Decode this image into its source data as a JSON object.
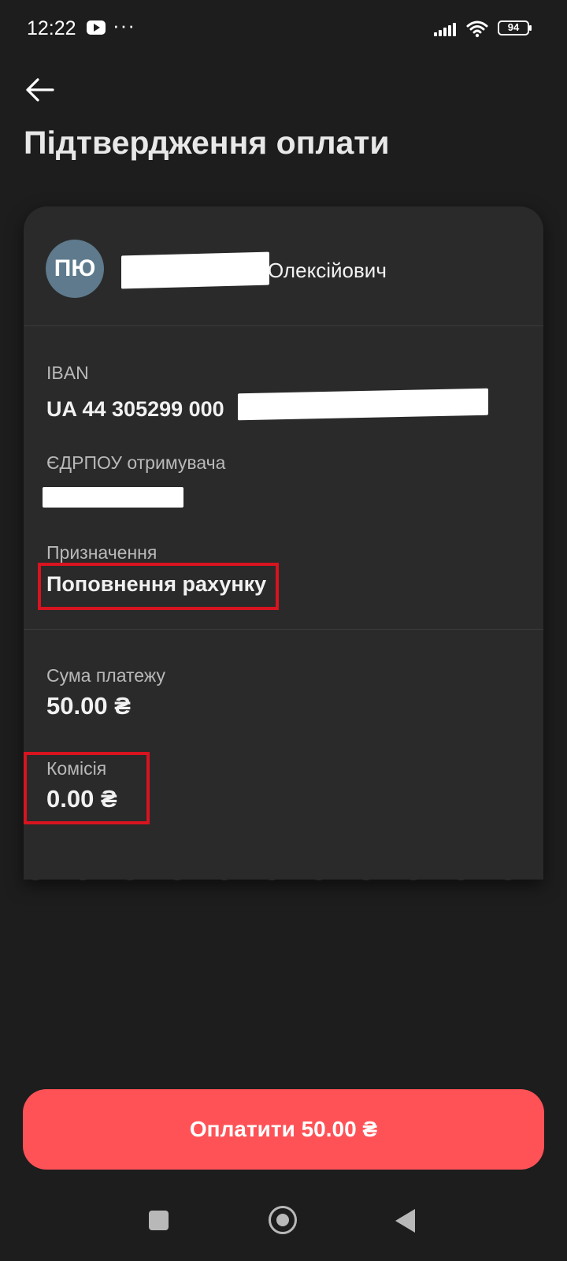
{
  "status_bar": {
    "time": "12:22",
    "more": "···",
    "battery_level": "94",
    "icons": [
      "youtube-icon",
      "more-icon",
      "signal-icon",
      "wifi-icon",
      "battery-icon"
    ]
  },
  "header": {
    "back_icon": "arrow-left-icon",
    "title": "Підтвердження оплати"
  },
  "recipient": {
    "initials": "ПЮ",
    "name_visible": "Олексійович"
  },
  "details": {
    "iban_label": "IBAN",
    "iban_value": "UA 44 305299 000",
    "edrpou_label": "ЄДРПОУ отримувача",
    "purpose_label": "Призначення",
    "purpose_value": "Поповнення рахунку"
  },
  "amounts": {
    "sum_label": "Сума платежу",
    "sum_value": "50.00 ₴",
    "fee_label": "Комісія",
    "fee_value": "0.00 ₴"
  },
  "pay_button": {
    "label": "Оплатити 50.00 ₴"
  },
  "colors": {
    "background": "#1d1d1d",
    "card": "#2a2a2a",
    "accent": "#ff5257",
    "avatar": "#5e7a8c",
    "highlight": "#d7141f"
  },
  "nav_bar": {
    "icons": [
      "recent-apps-icon",
      "home-icon",
      "back-icon"
    ]
  }
}
